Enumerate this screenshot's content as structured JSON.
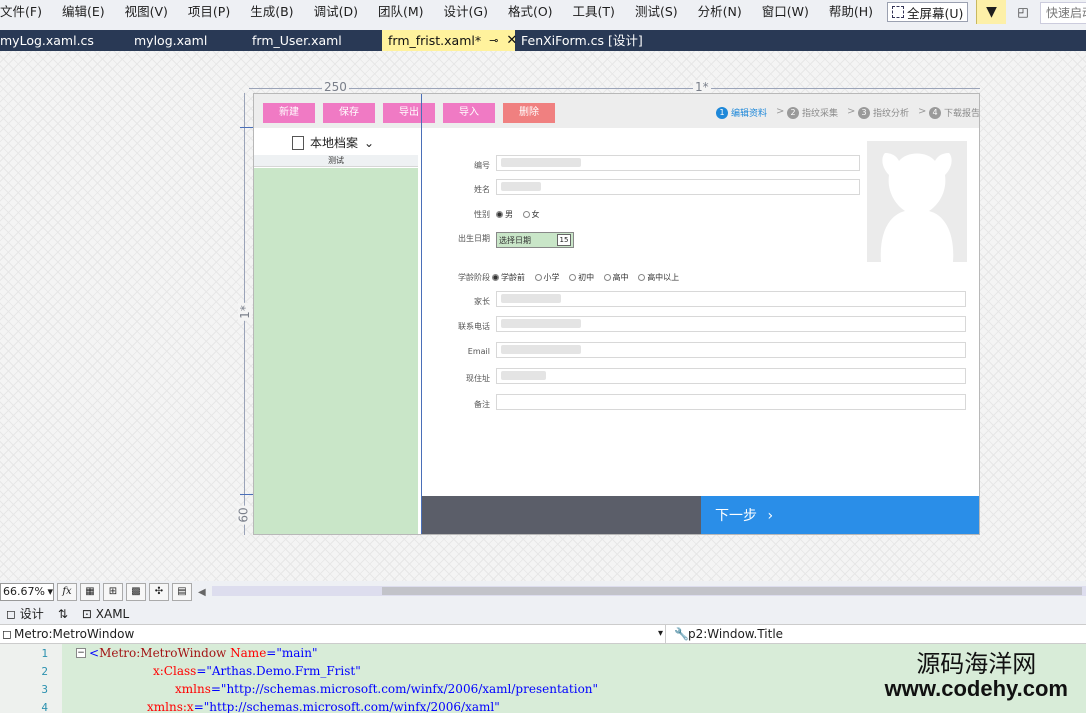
{
  "menu": [
    "文件(F)",
    "编辑(E)",
    "视图(V)",
    "项目(P)",
    "生成(B)",
    "调试(D)",
    "团队(M)",
    "设计(G)",
    "格式(O)",
    "工具(T)",
    "测试(S)",
    "分析(N)",
    "窗口(W)",
    "帮助(H)"
  ],
  "fullscreen_label": "全屏幕(U)",
  "quick_launch_placeholder": "快速启动",
  "tabs": [
    {
      "label": "myLog.xaml.cs"
    },
    {
      "label": "mylog.xaml"
    },
    {
      "label": "frm_User.xaml"
    },
    {
      "label": "frm_frist.xaml*",
      "active": true
    },
    {
      "label": "FenXiForm.cs [设计]"
    }
  ],
  "ruler": {
    "col1": "250",
    "col2": "1*",
    "row1": "1*",
    "row2": "60"
  },
  "app": {
    "buttons": [
      {
        "label": "新建",
        "color": "#f07ac4"
      },
      {
        "label": "保存",
        "color": "#f07ac4"
      },
      {
        "label": "导出",
        "color": "#f07ac4"
      },
      {
        "label": "导入",
        "color": "#f07ac4"
      },
      {
        "label": "删除",
        "color": "#f08080"
      }
    ],
    "steps": [
      {
        "num": "1",
        "label": "编辑资料",
        "active": true
      },
      {
        "num": "2",
        "label": "指纹采集"
      },
      {
        "num": "3",
        "label": "指纹分析"
      },
      {
        "num": "4",
        "label": "下载报告"
      }
    ],
    "archive_label": "本地档案",
    "list_header": "测试",
    "fields": {
      "number_label": "编号",
      "name_label": "姓名",
      "gender_label": "性别",
      "gender_options": [
        "男",
        "女"
      ],
      "birthday_label": "出生日期",
      "birthday_placeholder": "选择日期",
      "calendar_glyph": "15",
      "stage_label": "学龄阶段",
      "stage_options": [
        "学龄前",
        "小学",
        "初中",
        "高中",
        "高中以上"
      ],
      "parent_label": "家长",
      "phone_label": "联系电话",
      "email_label": "Email",
      "address_label": "现住址",
      "remark_label": "备注"
    },
    "next_label": "下一步",
    "next_chevron": "›"
  },
  "zoom": "66.67%",
  "view_tabs": {
    "design": "设计",
    "xaml": "XAML"
  },
  "crumbs": {
    "left": "Metro:MetroWindow",
    "right": "p2:Window.Title"
  },
  "code_lines": [
    {
      "n": "1",
      "tag": "Metro:MetroWindow",
      "attr": "Name",
      "val": "main"
    },
    {
      "n": "2",
      "attr": "x:Class",
      "val": "Arthas.Demo.Frm_Frist"
    },
    {
      "n": "3",
      "attr": "xmlns",
      "val": "http://schemas.microsoft.com/winfx/2006/xaml/presentation"
    },
    {
      "n": "4",
      "attr": "xmlns:x",
      "val": "http://schemas.microsoft.com/winfx/2006/xaml"
    }
  ],
  "watermark": {
    "line1": "源码海洋网",
    "line2": "www.codehy.com"
  }
}
